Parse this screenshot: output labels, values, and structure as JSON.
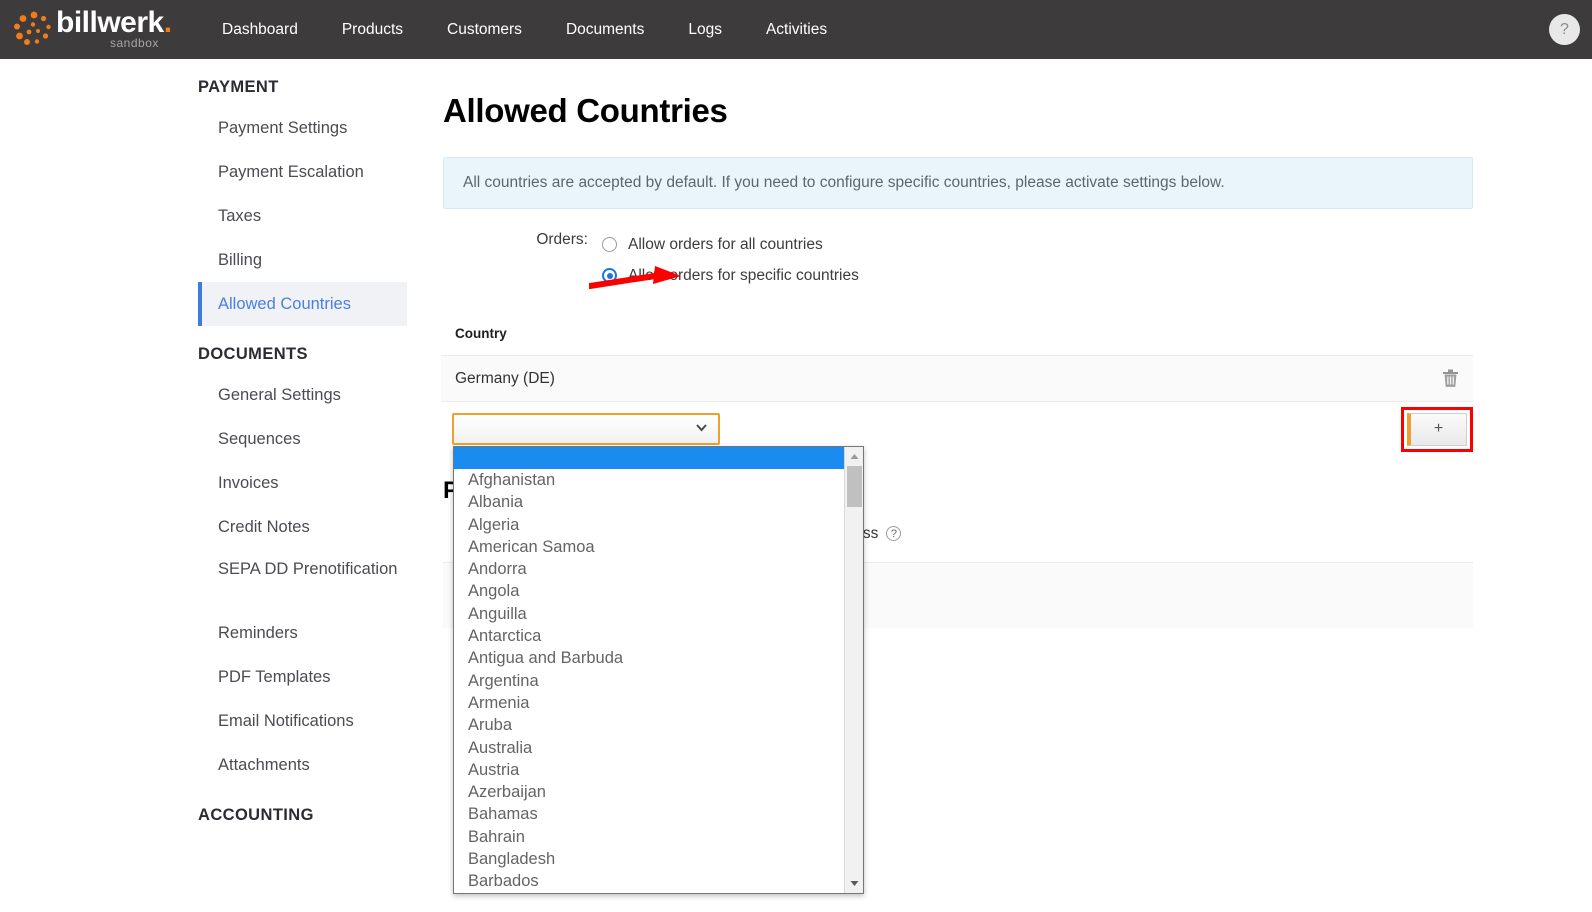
{
  "topnav": {
    "brand": {
      "word": "billwerk",
      "period": ".",
      "sub": "sandbox",
      "logo_icon": "billwerk-dots-logo"
    },
    "links": [
      {
        "label": "Dashboard"
      },
      {
        "label": "Products"
      },
      {
        "label": "Customers"
      },
      {
        "label": "Documents"
      },
      {
        "label": "Logs"
      },
      {
        "label": "Activities"
      }
    ],
    "help_label": "?",
    "bg_color": "#3d3b3c",
    "accent_color": "#f07d1a"
  },
  "sidebar": {
    "groups": [
      {
        "title": "PAYMENT",
        "items": [
          {
            "label": "Payment Settings",
            "active": false
          },
          {
            "label": "Payment Escalation",
            "active": false
          },
          {
            "label": "Taxes",
            "active": false
          },
          {
            "label": "Billing",
            "active": false
          },
          {
            "label": "Allowed Countries",
            "active": true
          }
        ]
      },
      {
        "title": "DOCUMENTS",
        "items": [
          {
            "label": "General Settings",
            "active": false
          },
          {
            "label": "Sequences",
            "active": false
          },
          {
            "label": "Invoices",
            "active": false
          },
          {
            "label": "Credit Notes",
            "active": false
          },
          {
            "label": "SEPA DD Prenotification",
            "active": false,
            "two_line": true
          },
          {
            "label": "Reminders",
            "active": false
          },
          {
            "label": "PDF Templates",
            "active": false
          },
          {
            "label": "Email Notifications",
            "active": false
          },
          {
            "label": "Attachments",
            "active": false
          }
        ]
      },
      {
        "title": "ACCOUNTING",
        "items": []
      }
    ],
    "active_color": "#4a7fe0",
    "active_bg": "#f1f2f6"
  },
  "main": {
    "page_title": "Allowed Countries",
    "info_banner": "All countries are accepted by default. If you need to configure specific countries, please activate settings below.",
    "orders": {
      "label": "Orders:",
      "options": [
        {
          "label": "Allow orders for all countries",
          "selected": false
        },
        {
          "label": "Allow orders for specific countries",
          "selected": true
        }
      ]
    },
    "table": {
      "header": "Country",
      "rows": [
        {
          "country": "Germany (DE)",
          "delete_icon": "trash-icon"
        }
      ]
    },
    "add_row": {
      "select_value": "",
      "select_placeholder": "",
      "chevron_icon": "chevron-down-icon",
      "add_label": "+"
    },
    "hidden_section": {
      "heading_fragment": "P",
      "line_fragment": "y must match with the customer address",
      "help_icon": "question-circle-icon"
    }
  },
  "dropdown": {
    "open": true,
    "selected_index": 0,
    "scroll_up_icon": "triangle-up-icon",
    "scroll_down_icon": "triangle-down-icon",
    "highlight_color": "#1a8cf0",
    "items": [
      "",
      "Afghanistan",
      "Albania",
      "Algeria",
      "American Samoa",
      "Andorra",
      "Angola",
      "Anguilla",
      "Antarctica",
      "Antigua and Barbuda",
      "Argentina",
      "Armenia",
      "Aruba",
      "Australia",
      "Austria",
      "Azerbaijan",
      "Bahamas",
      "Bahrain",
      "Bangladesh",
      "Barbados"
    ]
  },
  "annotations": {
    "arrow_color": "#fc0000",
    "arrow_target": "Allow orders for specific countries radio",
    "highlight_box_color": "#fc0000",
    "highlight_box_target": "add-country-button"
  }
}
